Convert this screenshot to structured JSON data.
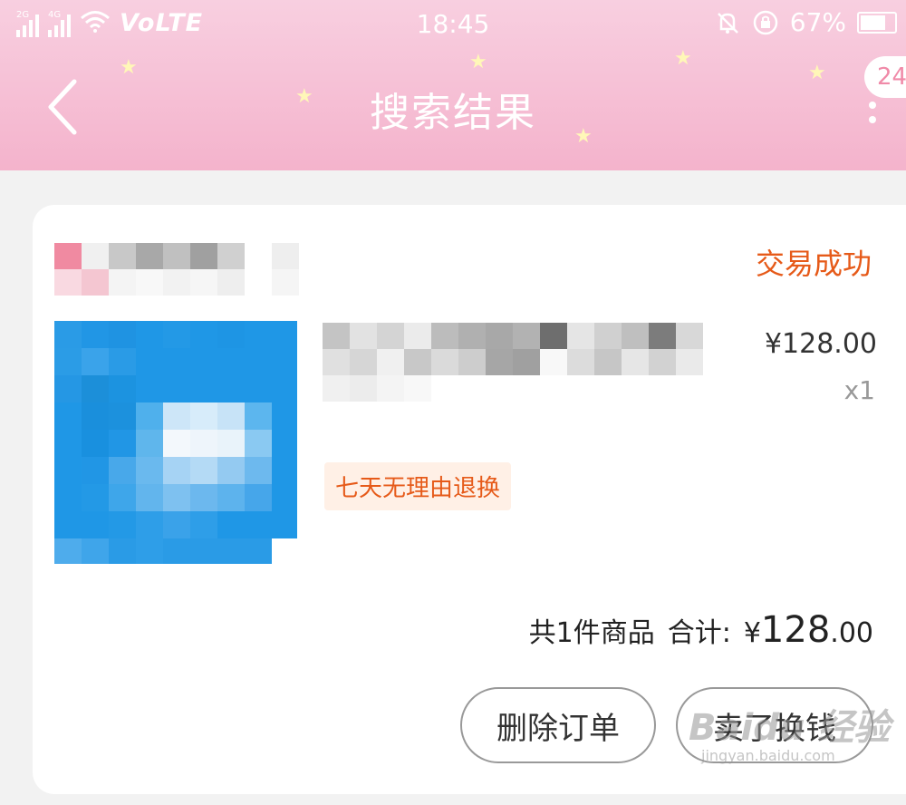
{
  "status_bar": {
    "network1": "2G",
    "network2": "4G",
    "volte": "VoLTE",
    "time": "18:45",
    "battery": "67%",
    "battery_level": 0.67
  },
  "header": {
    "title": "搜索结果",
    "badge": "24",
    "background": "#f4b3cc"
  },
  "order": {
    "status": "交易成功",
    "status_color": "#e65a19",
    "item": {
      "price": "¥128.00",
      "quantity": "x1",
      "tag": "七天无理由退换"
    },
    "summary": {
      "count": "共1件商品",
      "total_label": "合计:",
      "currency": "¥",
      "total_int": "128",
      "total_dec": ".00"
    },
    "actions": {
      "delete": "删除订单",
      "sell": "卖了换钱"
    }
  },
  "watermark": {
    "brand": "Baidu 经验",
    "site": "jingyan.baidu.com"
  }
}
